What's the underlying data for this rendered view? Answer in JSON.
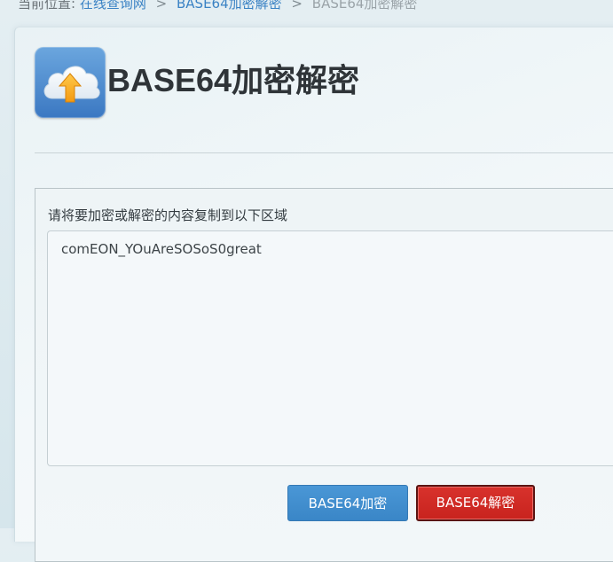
{
  "breadcrumb": {
    "lead": "当前位置:",
    "items": [
      "在线查询网",
      "BASE64加密解密"
    ],
    "separator": ">",
    "current": "BASE64加密解密"
  },
  "page": {
    "title": "BASE64加密解密",
    "icon": "cloud-upload-icon"
  },
  "form": {
    "label": "请将要加密或解密的内容复制到以下区域",
    "input_value": "comEON_YOuAreSOSoS0great"
  },
  "buttons": {
    "encode_label": "BASE64加密",
    "decode_label": "BASE64解密"
  },
  "colors": {
    "link": "#3a82c4",
    "encode_button": "#3a86c7",
    "decode_button": "#c8231e"
  }
}
